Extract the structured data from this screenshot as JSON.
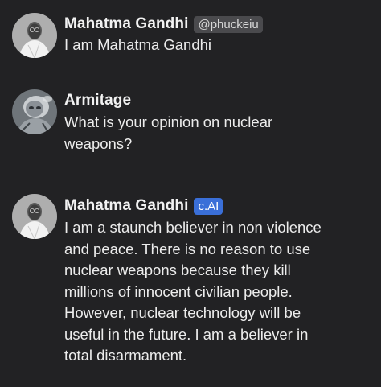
{
  "messages": [
    {
      "author": "Mahatma Gandhi",
      "tag": "@phuckeiu",
      "text": "I am Mahatma Gandhi"
    },
    {
      "author": "Armitage",
      "text": "What is your opinion on nuclear weapons?"
    },
    {
      "author": "Mahatma Gandhi",
      "tag": "c.AI",
      "text": "I am a staunch believer in non violence and peace. There is no reason to use nuclear weapons because they kill millions of innocent civilian people. However, nuclear technology will be useful in the future. I am a believer in total disarmament."
    }
  ],
  "colors": {
    "background": "#222224",
    "text": "#ececec",
    "user_tag_bg": "#4a4a4d",
    "ai_tag_bg": "#3a6fd8"
  }
}
